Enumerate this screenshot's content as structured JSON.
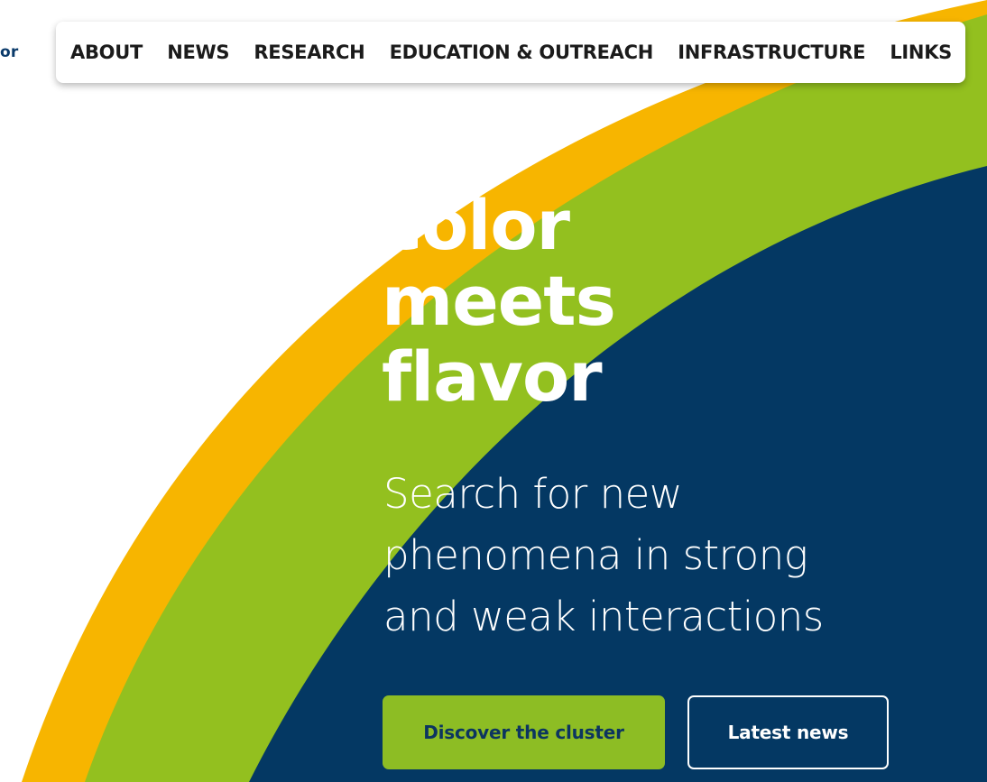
{
  "colors": {
    "yellow": "#f7b500",
    "green": "#93c01f",
    "navy": "#043863",
    "text_dark": "#1b1b1b"
  },
  "header": {
    "logo_fragment": "or",
    "nav_items": [
      "ABOUT",
      "NEWS",
      "RESEARCH",
      "EDUCATION & OUTREACH",
      "INFRASTRUCTURE",
      "LINKS"
    ]
  },
  "hero": {
    "title_lines": [
      "color",
      "meets",
      "flavor"
    ],
    "subtitle_lines": [
      "Search for new",
      "phenomena in strong",
      "and weak interactions"
    ],
    "primary_button": "Discover the cluster",
    "secondary_button": "Latest news"
  }
}
